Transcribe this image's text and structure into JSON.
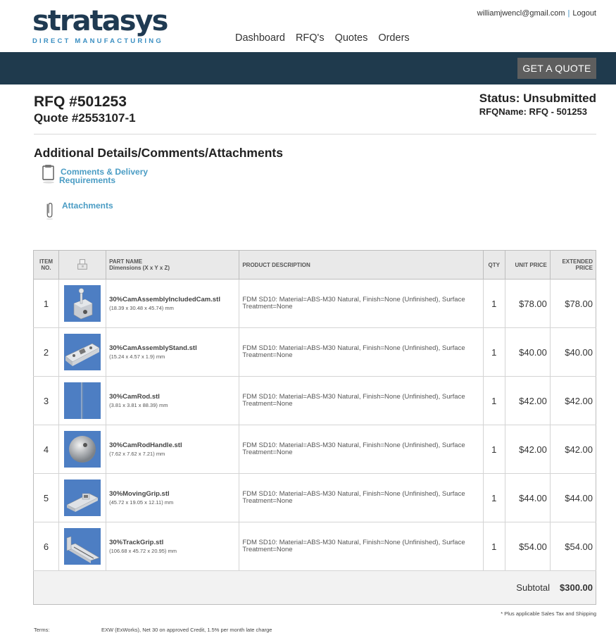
{
  "header": {
    "logo_word": "stratasys",
    "logo_sub": "DIRECT MANUFACTURING",
    "user_email": "williamjwencl@gmail.com",
    "separator": "|",
    "logout": "Logout",
    "nav": [
      "Dashboard",
      "RFQ's",
      "Quotes",
      "Orders"
    ],
    "get_quote": "GET A QUOTE"
  },
  "rfq": {
    "number": "RFQ #501253",
    "quote": "Quote #2553107-1",
    "status": "Status: Unsubmitted",
    "rfq_name": "RFQName: RFQ - 501253"
  },
  "details": {
    "title": "Additional Details/Comments/Attachments",
    "comments_line1": "Comments & Delivery",
    "comments_line2": "Requirements",
    "attachments": "Attachments"
  },
  "table": {
    "headers": {
      "item": "ITEM NO.",
      "part": "PART NAME",
      "part_sub": "Dimensions (X x Y x Z)",
      "desc": "PRODUCT DESCRIPTION",
      "qty": "QTY",
      "unit": "UNIT PRICE",
      "ext": "EXTENDED PRICE"
    },
    "rows": [
      {
        "no": "1",
        "name": "30%CamAssemblyIncludedCam.stl",
        "dims": "(18.39 x 30.48 x 45.74) mm",
        "desc": "FDM SD10: Material=ABS-M30 Natural, Finish=None (Unfinished), Surface Treatment=None",
        "qty": "1",
        "unit": "$78.00",
        "ext": "$78.00"
      },
      {
        "no": "2",
        "name": "30%CamAssemblyStand.stl",
        "dims": "(15.24 x 4.57 x 1.9) mm",
        "desc": "FDM SD10: Material=ABS-M30 Natural, Finish=None (Unfinished), Surface Treatment=None",
        "qty": "1",
        "unit": "$40.00",
        "ext": "$40.00"
      },
      {
        "no": "3",
        "name": "30%CamRod.stl",
        "dims": "(3.81 x 3.81 x 88.39) mm",
        "desc": "FDM SD10: Material=ABS-M30 Natural, Finish=None (Unfinished), Surface Treatment=None",
        "qty": "1",
        "unit": "$42.00",
        "ext": "$42.00"
      },
      {
        "no": "4",
        "name": "30%CamRodHandle.stl",
        "dims": "(7.62 x 7.62 x 7.21) mm",
        "desc": "FDM SD10: Material=ABS-M30 Natural, Finish=None (Unfinished), Surface Treatment=None",
        "qty": "1",
        "unit": "$42.00",
        "ext": "$42.00"
      },
      {
        "no": "5",
        "name": "30%MovingGrip.stl",
        "dims": "(45.72 x 19.05 x 12.11) mm",
        "desc": "FDM SD10: Material=ABS-M30 Natural, Finish=None (Unfinished), Surface Treatment=None",
        "qty": "1",
        "unit": "$44.00",
        "ext": "$44.00"
      },
      {
        "no": "6",
        "name": "30%TrackGrip.stl",
        "dims": "(106.68 x 45.72 x 20.95) mm",
        "desc": "FDM SD10: Material=ABS-M30 Natural, Finish=None (Unfinished), Surface Treatment=None",
        "qty": "1",
        "unit": "$54.00",
        "ext": "$54.00"
      }
    ],
    "subtotal_label": "Subtotal",
    "subtotal_value": "$300.00"
  },
  "footnote": "* Plus applicable Sales Tax and Shipping",
  "terms": {
    "label": "Terms:",
    "value": "EXW (ExWorks), Net 30 on approved Credit, 1.5% per month late charge"
  },
  "colors": {
    "brand_dark": "#1f3a52",
    "brand_blue": "#3b8fc2",
    "topbar": "#1f3a4d",
    "link": "#4a9cc4",
    "thumb_bg": "#4d7ec3"
  }
}
